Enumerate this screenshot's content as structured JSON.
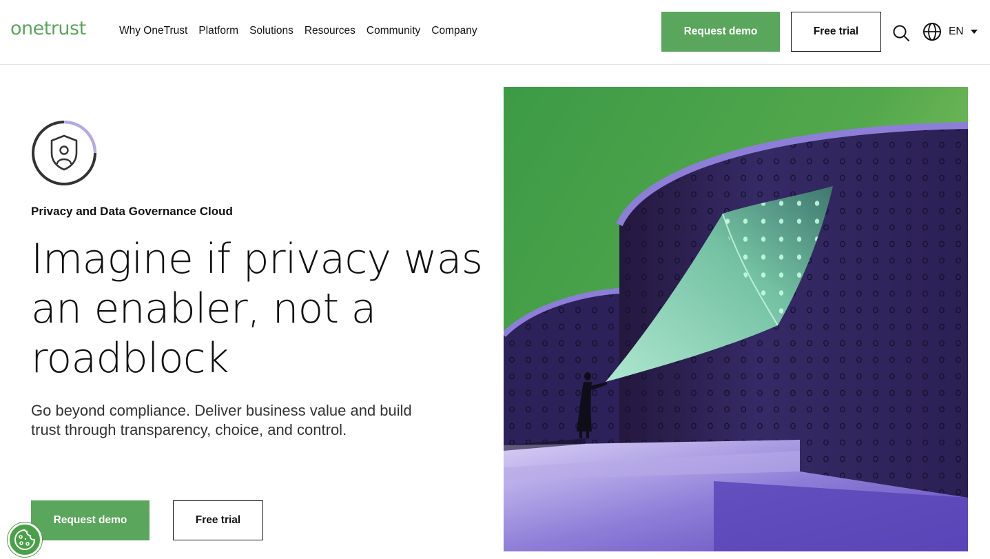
{
  "header": {
    "logo_text": "onetrust",
    "nav": [
      {
        "label": "Why OneTrust"
      },
      {
        "label": "Platform"
      },
      {
        "label": "Solutions"
      },
      {
        "label": "Resources"
      },
      {
        "label": "Community"
      },
      {
        "label": "Company"
      }
    ],
    "request_demo_label": "Request demo",
    "free_trial_label": "Free trial",
    "language": "EN",
    "icons": [
      "search-icon",
      "globe-icon",
      "caret-down-icon"
    ]
  },
  "hero": {
    "eyebrow": "Privacy and Data Governance Cloud",
    "headline_lines": [
      "Imagine if privacy was",
      "an enabler, not a",
      "roadblock"
    ],
    "subheadline_lines": [
      "Go beyond compliance. Deliver business value and build",
      "trust through transparency, choice, and control."
    ],
    "request_demo_label": "Request demo",
    "free_trial_label": "Free trial",
    "badge_icon": "shield-user-icon"
  },
  "cookie_button": {
    "icon": "cookie-icon"
  },
  "colors": {
    "brand_green": "#5aa65c",
    "text": "#111111",
    "purple_dark": "#3a2c6b",
    "purple_light": "#9d8de0",
    "badge_arc": "#b7a9e8"
  }
}
